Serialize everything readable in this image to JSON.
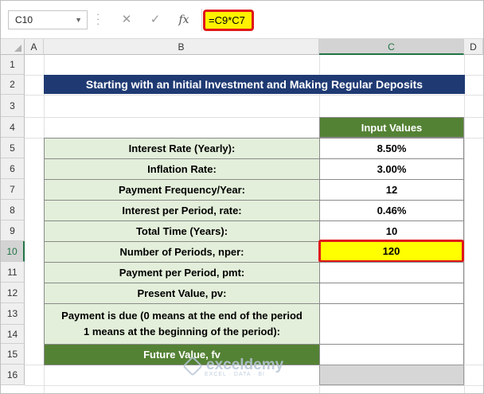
{
  "formula_bar": {
    "name_box": "C10",
    "cancel_icon": "✕",
    "enter_icon": "✓",
    "fx_label": "fx",
    "formula": "=C9*C7"
  },
  "columns": [
    "A",
    "B",
    "C",
    "D"
  ],
  "rows": [
    "1",
    "2",
    "3",
    "4",
    "5",
    "6",
    "7",
    "8",
    "9",
    "10",
    "11",
    "12",
    "13",
    "14",
    "15",
    "16"
  ],
  "selected_cell": "C10",
  "title": "Starting with an Initial Investment and Making Regular Deposits",
  "table_header": "Input Values",
  "table": [
    {
      "label": "Interest Rate (Yearly):",
      "value": "8.50%"
    },
    {
      "label": "Inflation Rate:",
      "value": "3.00%"
    },
    {
      "label": "Payment Frequency/Year:",
      "value": "12"
    },
    {
      "label": "Interest per Period, rate:",
      "value": "0.46%"
    },
    {
      "label": "Total Time (Years):",
      "value": "10"
    },
    {
      "label": "Number of Periods, nper:",
      "value": "120"
    },
    {
      "label": "Payment per Period, pmt:",
      "value": ""
    },
    {
      "label": "Present Value, pv:",
      "value": ""
    }
  ],
  "payment_due_label_1": "Payment is due (0 means at the end of the period",
  "payment_due_label_2": "1 means at the beginning of the period):",
  "future_value_label": "Future Value, fv",
  "watermark": {
    "name": "exceldemy",
    "tagline": "EXCEL · DATA · BI"
  },
  "colors": {
    "title_bg": "#1f3a73",
    "header_green": "#548235",
    "label_bg": "#e3efda",
    "highlight": "#ffff00",
    "border_red": "#e0161a"
  }
}
